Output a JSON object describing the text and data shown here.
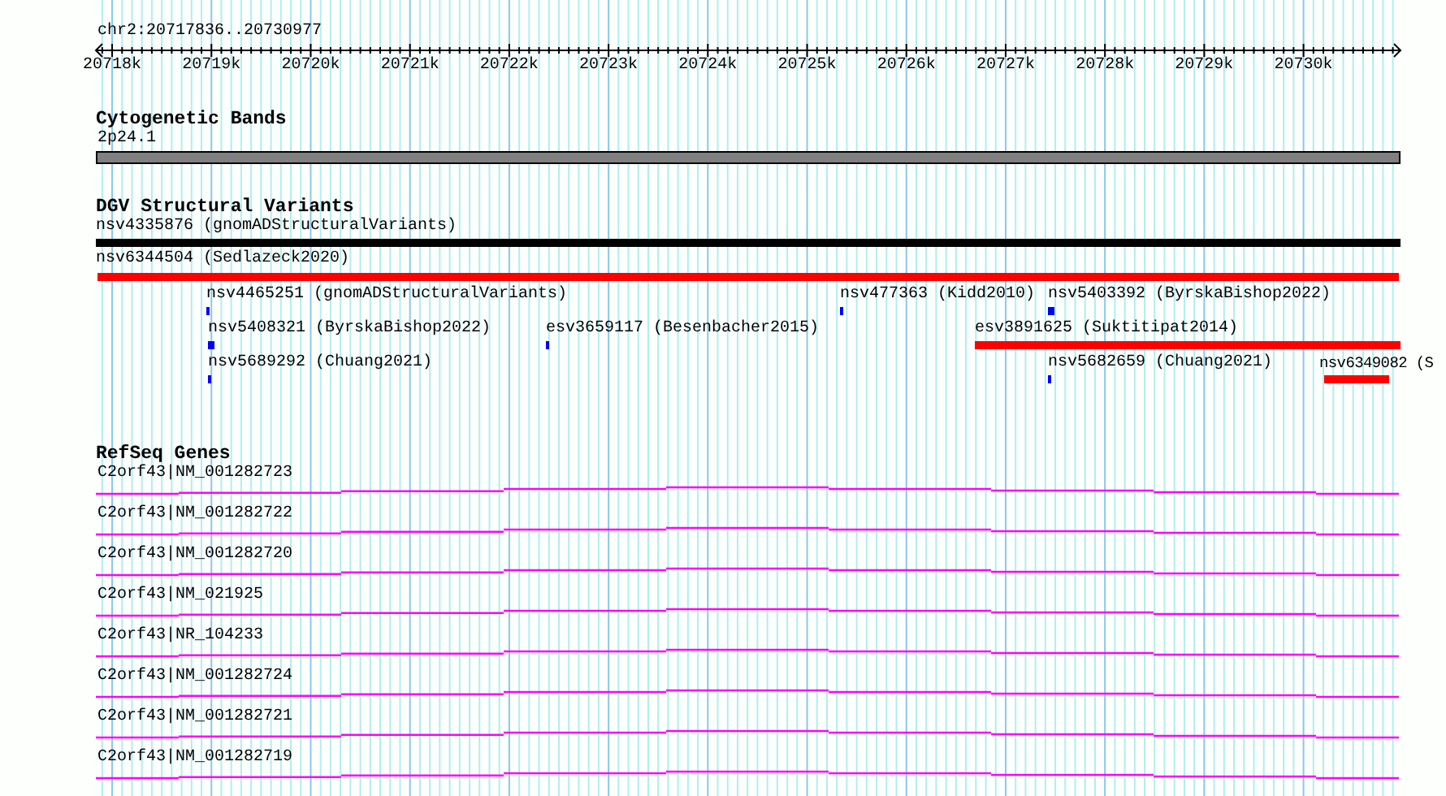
{
  "ruler": {
    "title": "chr2:20717836..20730977",
    "ticks": [
      "20718k",
      "20719k",
      "20720k",
      "20721k",
      "20722k",
      "20723k",
      "20724k",
      "20725k",
      "20726k",
      "20727k",
      "20728k",
      "20729k",
      "20730k"
    ]
  },
  "tracks": [
    {
      "kind": "bands",
      "title": "Cytogenetic Bands",
      "features": [
        {
          "label": "2p24.1",
          "color": "#808080"
        }
      ]
    },
    {
      "kind": "variants",
      "title": "DGV Structural Variants",
      "features": [
        {
          "label": "nsv4335876 (gnomADStructuralVariants)",
          "color": "#000000"
        },
        {
          "label": "nsv6344504 (Sedlazeck2020)",
          "color": "#ff0000"
        },
        {
          "label": "nsv4465251 (gnomADStructuralVariants)",
          "color": "#0000ff"
        },
        {
          "label": "nsv477363 (Kidd2010)",
          "color": "#0000ff"
        },
        {
          "label": "nsv5403392 (ByrskaBishop2022)",
          "color": "#0000ff"
        },
        {
          "label": "nsv5408321 (ByrskaBishop2022)",
          "color": "#0000ff"
        },
        {
          "label": "esv3659117 (Besenbacher2015)",
          "color": "#0000ff"
        },
        {
          "label": "esv3891625 (Suktitipat2014)",
          "color": "#ff0000"
        },
        {
          "label": "nsv5689292 (Chuang2021)",
          "color": "#0000ff"
        },
        {
          "label": "nsv5682659 (Chuang2021)",
          "color": "#0000ff"
        },
        {
          "label": "nsv6349082 (S",
          "color": "#ff0000"
        }
      ]
    },
    {
      "kind": "genes",
      "title": "RefSeq Genes",
      "features": [
        {
          "label": "C2orf43|NM_001282723"
        },
        {
          "label": "C2orf43|NM_001282722"
        },
        {
          "label": "C2orf43|NM_001282720"
        },
        {
          "label": "C2orf43|NM_021925"
        },
        {
          "label": "C2orf43|NR_104233"
        },
        {
          "label": "C2orf43|NM_001282724"
        },
        {
          "label": "C2orf43|NM_001282721"
        },
        {
          "label": "C2orf43|NM_001282719"
        }
      ]
    }
  ]
}
